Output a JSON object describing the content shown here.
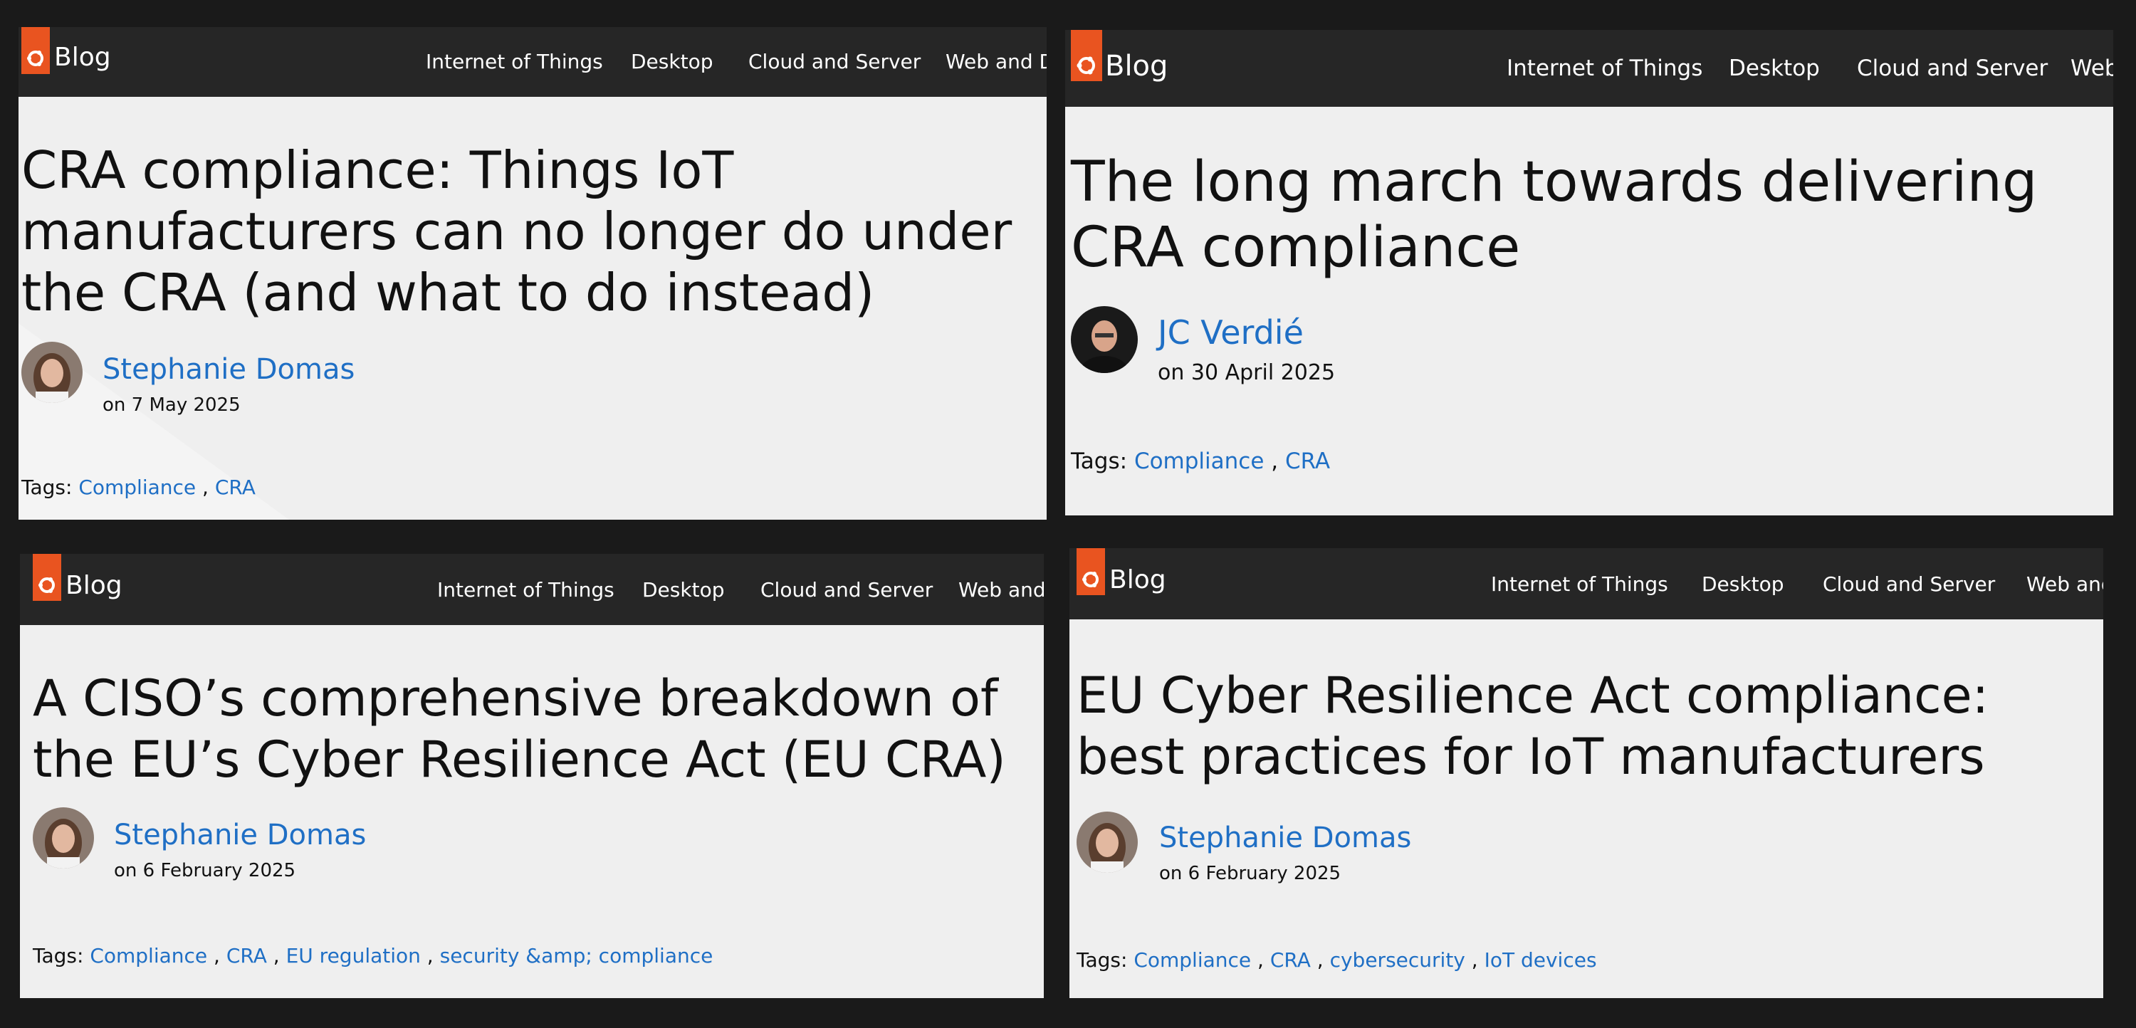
{
  "theme": {
    "accent": "#e95420",
    "nav_bg": "#262626",
    "page_bg": "#efefef",
    "link": "#1f6fc5",
    "frame_bg": "#1a1a1a"
  },
  "nav": {
    "brand": "Blog",
    "logo_icon": "ubuntu-circle-of-friends-icon",
    "items": [
      "Internet of Things",
      "Desktop",
      "Cloud and Server",
      "Web and Devices"
    ]
  },
  "tags_label": "Tags:",
  "posts": [
    {
      "title": "CRA compliance: Things IoT manufacturers can no longer do under the CRA (and what to do instead)",
      "author": "Stephanie Domas",
      "date": "on 7 May 2025",
      "tags": [
        "Compliance",
        "CRA"
      ]
    },
    {
      "title": "The long march towards delivering CRA compliance",
      "author": "JC Verdié",
      "date": "on 30 April 2025",
      "tags": [
        "Compliance",
        "CRA"
      ]
    },
    {
      "title": "A CISO’s comprehensive breakdown of the EU’s Cyber Resilience Act (EU CRA)",
      "author": "Stephanie Domas",
      "date": "on 6 February 2025",
      "tags": [
        "Compliance",
        "CRA",
        "EU regulation",
        "security &amp; compliance"
      ]
    },
    {
      "title": "EU Cyber Resilience Act compliance: best practices for IoT manufacturers",
      "author": "Stephanie Domas",
      "date": "on 6 February 2025",
      "tags": [
        "Compliance",
        "CRA",
        "cybersecurity",
        "IoT devices"
      ]
    }
  ]
}
